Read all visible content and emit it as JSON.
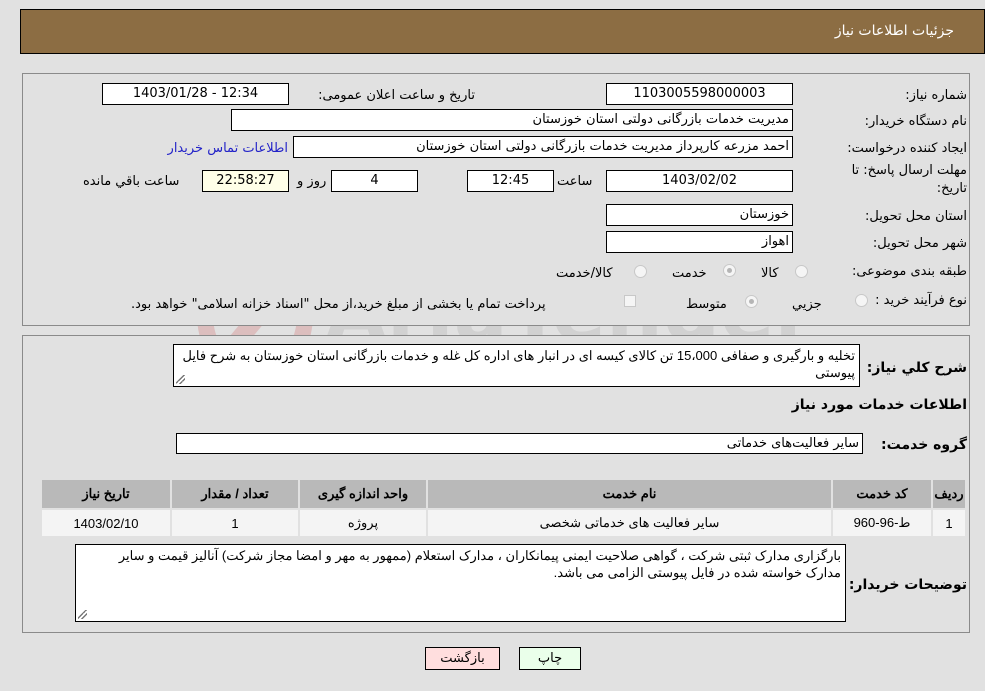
{
  "header": {
    "title": "جزئیات اطلاعات نیاز"
  },
  "form": {
    "need_number": {
      "label": "شماره نیاز:",
      "value": "1103005598000003"
    },
    "announce_datetime": {
      "label": "تاریخ و ساعت اعلان عمومی:",
      "value": "1403/01/28 - 12:34"
    },
    "buyer_org": {
      "label": "نام دستگاه خریدار:",
      "value": "مدیریت خدمات بازرگانی دولتی استان خوزستان"
    },
    "requester": {
      "label": "ایجاد کننده درخواست:",
      "value": "احمد مزرعه کارپرداز مدیریت خدمات بازرگانی دولتی استان خوزستان"
    },
    "buyer_contact_link": "اطلاعات تماس خریدار",
    "deadline": {
      "label_line1": "مهلت ارسال پاسخ: تا",
      "label_line2": "تاریخ:",
      "date": "1403/02/02",
      "time_label": "ساعت",
      "time": "12:45",
      "days": "4",
      "days_label": "روز و",
      "remaining": "22:58:27",
      "remaining_label": "ساعت باقي مانده"
    },
    "delivery_province": {
      "label": "استان محل تحویل:",
      "value": "خوزستان"
    },
    "delivery_city": {
      "label": "شهر محل تحویل:",
      "value": "اهواز"
    },
    "category": {
      "label": "طبقه بندی موضوعی:",
      "options": [
        "کالا",
        "خدمت",
        "کالا/خدمت"
      ],
      "selected": "خدمت"
    },
    "purchase_type": {
      "label": "نوع فرآیند خرید :",
      "options": [
        "جزيي",
        "متوسط"
      ],
      "selected": "متوسط",
      "treasury_note": "پرداخت تمام یا بخشی از مبلغ خرید،از محل \"اسناد خزانه اسلامی\" خواهد بود."
    }
  },
  "description": {
    "label": "شرح كلي نياز:",
    "value": "تخلیه و بارگیری و صفافی 15،000 تن کالای کیسه ای در انبار های اداره کل غله و خدمات بازرگانی استان خوزستان به شرح فایل پیوستی"
  },
  "services": {
    "section_title": "اطلاعات خدمات مورد نیاز",
    "group_label": "گروه خدمت:",
    "group_value": "سایر فعالیت‌های خدماتی",
    "columns": [
      "ردیف",
      "کد خدمت",
      "نام خدمت",
      "واحد اندازه گیری",
      "تعداد / مقدار",
      "تاریخ نیاز"
    ],
    "rows": [
      [
        "1",
        "ط-96-960",
        "سایر فعالیت های خدماتی شخصی",
        "پروژه",
        "1",
        "1403/02/10"
      ]
    ]
  },
  "buyer_notes": {
    "label": "توضیحات خریدار:",
    "value": "بارگزاری مدارک ثبتی شرکت ، گواهی صلاحیت ایمنی پیمانکاران ، مدارک استعلام (ممهور به مهر و امضا مجاز شرکت) آنالیز قیمت و سایر مدارک خواسته شده در فایل پیوستی الزامی می باشد."
  },
  "buttons": {
    "print": "چاپ",
    "back": "بازگشت"
  },
  "colors": {
    "header_bg": "#8c6d43",
    "print_bg": "#eaffea",
    "back_bg": "#ffdede",
    "link": "#2323c8"
  }
}
